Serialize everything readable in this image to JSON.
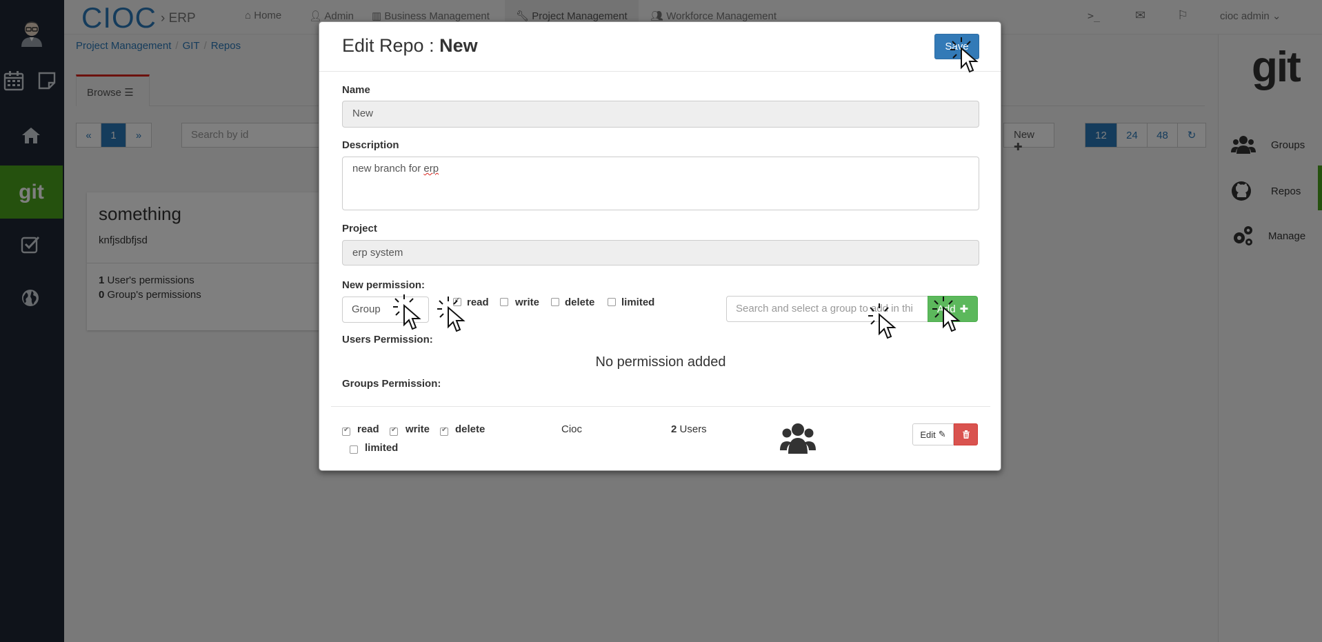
{
  "app": {
    "brand": "CIOC",
    "brand_sub": "› ERP"
  },
  "topnav": {
    "items": [
      {
        "label": "Home"
      },
      {
        "label": "Admin"
      },
      {
        "label": "Business Management"
      },
      {
        "label": "Project Management"
      },
      {
        "label": "Workforce Management"
      }
    ],
    "terminal": ">_",
    "user": "cioc admin"
  },
  "leftbar": {
    "git_label": "git"
  },
  "breadcrumb": [
    "Project Management",
    "GIT",
    "Repos"
  ],
  "tabs": {
    "browse": "Browse"
  },
  "pager": {
    "prev": "«",
    "page": "1",
    "next": "»",
    "sizes": [
      "12",
      "24",
      "48"
    ]
  },
  "search": {
    "placeholder": "Search by id"
  },
  "new_button": "New",
  "card": {
    "title": "something",
    "description": "knfjsdbfjsd",
    "users_count": "1",
    "users_label": "User's permissions",
    "groups_count": "0",
    "groups_label": "Group's permissions"
  },
  "rightbar": {
    "logo": "git",
    "items": [
      {
        "label": "Groups"
      },
      {
        "label": "Repos"
      },
      {
        "label": "Manage"
      }
    ]
  },
  "modal": {
    "title_prefix": "Edit Repo : ",
    "title_name": "New",
    "save_label": "Save",
    "name_label": "Name",
    "name_value": "New",
    "description_label": "Description",
    "description_value_1": "new branch for ",
    "description_value_2": "erp",
    "project_label": "Project",
    "project_value": "erp system",
    "new_permission_label": "New permission:",
    "type_select": "Group",
    "perms": {
      "read": "read",
      "write": "write",
      "delete": "delete",
      "limited": "limited"
    },
    "group_search_placeholder": "Search and select a group to add in thi",
    "add_label": "Add",
    "users_permission_label": "Users Permission:",
    "no_permission": "No permission added",
    "groups_permission_label": "Groups Permission:",
    "group_row": {
      "read": "read",
      "write": "write",
      "delete": "delete",
      "limited": "limited",
      "name": "Cioc",
      "users_count": "2",
      "users_label": "Users",
      "edit_label": "Edit"
    }
  }
}
